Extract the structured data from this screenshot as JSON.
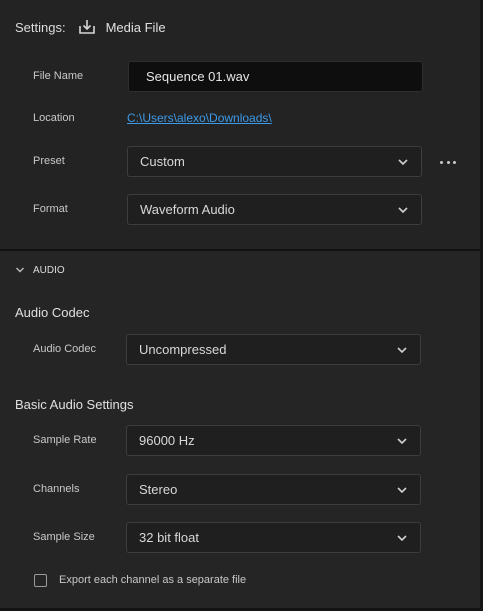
{
  "header": {
    "settings_label": "Settings:",
    "media_file_label": "Media File"
  },
  "file_name": {
    "label": "File Name",
    "value": "Sequence 01.wav"
  },
  "location": {
    "label": "Location",
    "value": "C:\\Users\\alexo\\Downloads\\"
  },
  "preset": {
    "label": "Preset",
    "value": "Custom"
  },
  "format": {
    "label": "Format",
    "value": "Waveform Audio"
  },
  "audio_section": {
    "label": "AUDIO"
  },
  "audio_codec": {
    "title": "Audio Codec",
    "label": "Audio Codec",
    "value": "Uncompressed"
  },
  "basic_audio": {
    "title": "Basic Audio Settings",
    "sample_rate": {
      "label": "Sample Rate",
      "value": "96000 Hz"
    },
    "channels": {
      "label": "Channels",
      "value": "Stereo"
    },
    "sample_size": {
      "label": "Sample Size",
      "value": "32 bit float"
    }
  },
  "export_channels": {
    "label": "Export each channel as a separate file",
    "checked": false
  },
  "colors": {
    "panel_bg": "#232323",
    "link": "#3d9ae8",
    "field_dark": "#0e0e0e",
    "select_bg": "#1f1f1f"
  },
  "icons": [
    "download-icon",
    "chevron-down-icon",
    "more-icon",
    "checkbox-icon"
  ]
}
